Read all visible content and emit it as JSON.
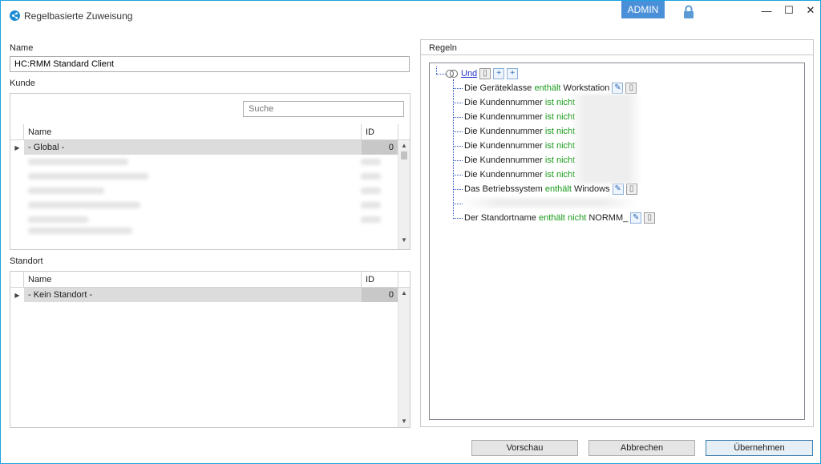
{
  "window": {
    "title": "Regelbasierte Zuweisung",
    "badge": "ADMIN",
    "controls": {
      "minimize": "—",
      "maximize": "☐",
      "close": "✕"
    }
  },
  "form": {
    "name_label": "Name",
    "name_value": "HC:RMM Standard Client",
    "kunde_label": "Kunde",
    "search_placeholder": "Suche",
    "standort_label": "Standort"
  },
  "kunde_grid": {
    "columns": {
      "name": "Name",
      "id": "ID"
    },
    "selected_row": {
      "name": "- Global -",
      "id": "0"
    }
  },
  "standort_grid": {
    "columns": {
      "name": "Name",
      "id": "ID"
    },
    "selected_row": {
      "name": "- Kein Standort -",
      "id": "0"
    }
  },
  "rules": {
    "label": "Regeln",
    "root": "Und",
    "items": [
      {
        "subject": "Die Geräteklasse",
        "op": "enthält",
        "value": "Workstation"
      },
      {
        "subject": "Die Kundennummer",
        "op": "ist nicht",
        "value": ""
      },
      {
        "subject": "Die Kundennummer",
        "op": "ist nicht",
        "value": ""
      },
      {
        "subject": "Die Kundennummer",
        "op": "ist nicht",
        "value": ""
      },
      {
        "subject": "Die Kundennummer",
        "op": "ist nicht",
        "value": ""
      },
      {
        "subject": "Die Kundennummer",
        "op": "ist nicht",
        "value": ""
      },
      {
        "subject": "Die Kundennummer",
        "op": "ist nicht",
        "value": ""
      },
      {
        "subject": "Das Betriebssystem",
        "op": "enthält",
        "value": "Windows"
      },
      {
        "subject": "Der Standortname",
        "op": "enthält nicht",
        "value": "NORMM_"
      }
    ]
  },
  "buttons": {
    "preview": "Vorschau",
    "cancel": "Abbrechen",
    "apply": "Übernehmen"
  },
  "colors": {
    "accent": "#1ba1e2",
    "badge": "#4a90d9",
    "operator": "#1a9a1a",
    "tree_line": "#2a52be"
  }
}
